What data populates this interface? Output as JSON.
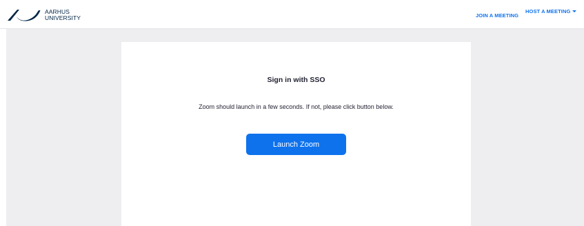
{
  "header": {
    "logo": {
      "icon": "aarhus-university-logo-mark",
      "line1": "AARHUS",
      "line2": "UNIVERSITY"
    },
    "nav": {
      "join_label": "JOIN A MEETING",
      "host_label": "HOST A MEETING",
      "host_icon": "caret-down-icon"
    }
  },
  "main": {
    "title": "Sign in with SSO",
    "message": "Zoom should launch in a few seconds. If not, please click button below.",
    "launch_label": "Launch Zoom"
  },
  "colors": {
    "accent": "#0e72ed",
    "logo": "#002546",
    "background": "#eeeef0",
    "card": "#ffffff"
  }
}
